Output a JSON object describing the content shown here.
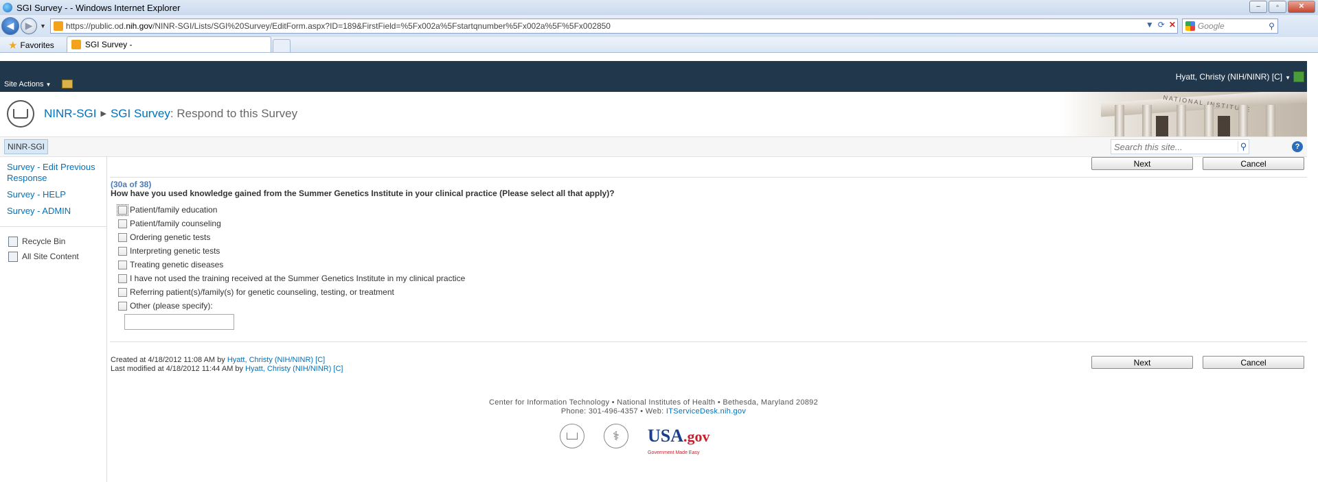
{
  "browser": {
    "window_title": "SGI Survey - - Windows Internet Explorer",
    "url_prefix": "https://public.od.",
    "url_domain": "nih.gov",
    "url_rest": "/NINR-SGI/Lists/SGI%20Survey/EditForm.aspx?ID=189&FirstField=%5Fx002a%5Fstartqnumber%5Fx002a%5F%5Fx002850",
    "search_placeholder": "Google",
    "favorites_label": "Favorites",
    "tab_label": "SGI Survey -"
  },
  "ribbon": {
    "site_actions": "Site Actions",
    "user_name": "Hyatt, Christy (NIH/NINR) [C]"
  },
  "header": {
    "site_name": "NINR-SGI",
    "list_name": "SGI Survey",
    "page_title": ": Respond to this Survey",
    "building_text": "NATIONAL INSTITUTE"
  },
  "topnav": {
    "home_label": "NINR-SGI",
    "search_placeholder": "Search this site...",
    "help_label": "?"
  },
  "quicklaunch": {
    "links": [
      "Survey - Edit Previous Response",
      "Survey - HELP",
      "Survey - ADMIN"
    ],
    "recycle_bin": "Recycle Bin",
    "all_site_content": "All Site Content"
  },
  "form": {
    "next_label": "Next",
    "cancel_label": "Cancel",
    "question_number": "(30a of 38)",
    "question_text": "How have you used knowledge gained from the Summer Genetics Institute in your clinical practice (Please select all that apply)?",
    "options": [
      "Patient/family education",
      "Patient/family counseling",
      "Ordering genetic tests",
      "Interpreting genetic tests",
      "Treating genetic diseases",
      "I have not used the training received at the Summer Genetics Institute in my clinical practice",
      "Referring patient(s)/family(s) for genetic counseling, testing, or treatment",
      "Other (please specify):"
    ],
    "other_value": ""
  },
  "meta": {
    "created_prefix": "Created at 4/18/2012 11:08 AM  by ",
    "created_by": "Hyatt, Christy (NIH/NINR) [C]",
    "modified_prefix": "Last modified at 4/18/2012 11:44 AM  by ",
    "modified_by": "Hyatt, Christy (NIH/NINR) [C]"
  },
  "footer": {
    "line1": "Center for Information Technology • National Institutes of Health • Bethesda, Maryland 20892",
    "line2_prefix": "Phone: 301-496-4357 • Web: ",
    "line2_link": "ITServiceDesk.nih.gov",
    "usa_logo": "USA",
    "usa_gov": ".gov",
    "usa_tagline": "Government Made Easy"
  }
}
